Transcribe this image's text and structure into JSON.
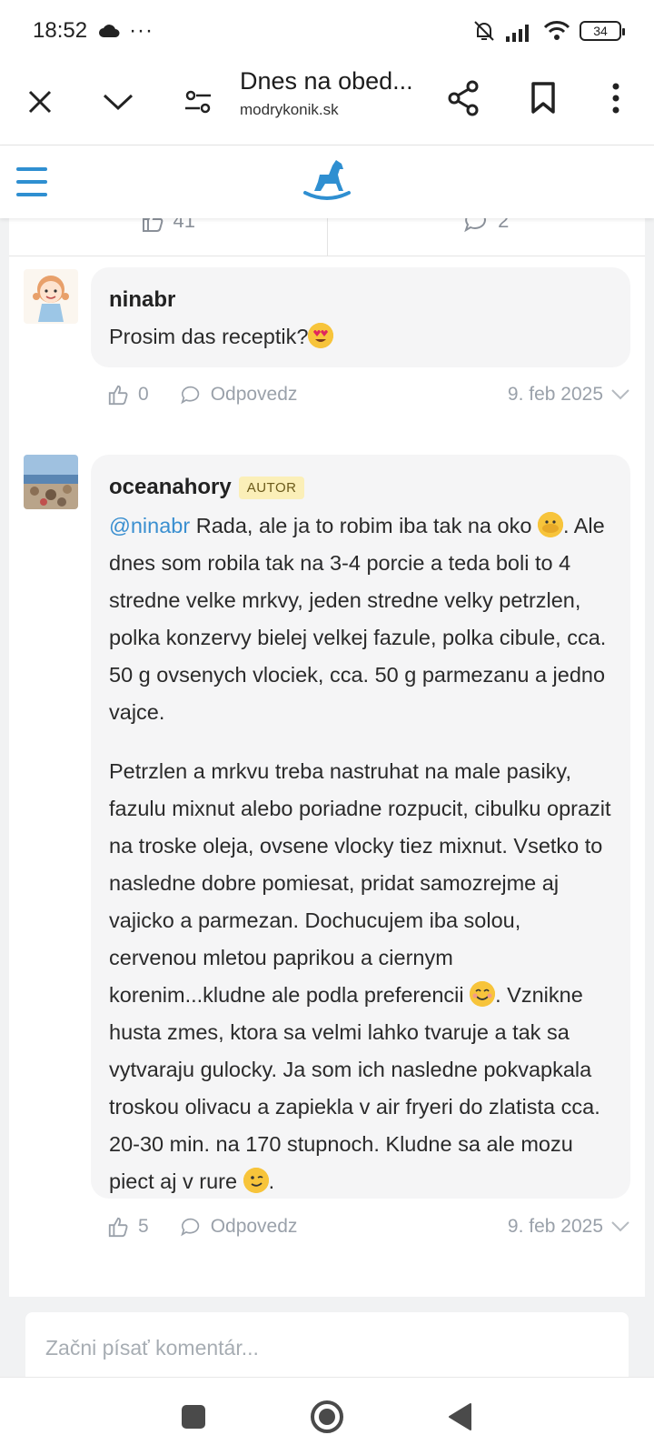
{
  "status_bar": {
    "time": "18:52",
    "overflow": "···",
    "battery": "34"
  },
  "toolbar": {
    "title": "Dnes na obed...",
    "url": "modrykonik.sk"
  },
  "stats": {
    "likes": "41",
    "comments": "2"
  },
  "comments": [
    {
      "author": "ninabr",
      "text": "Prosim das receptik?",
      "likes": "0",
      "reply_label": "Odpovedz",
      "date": "9. feb 2025"
    },
    {
      "author": "oceanahory",
      "badge": "AUTOR",
      "mention": "@ninabr",
      "p1": " Rada, ale ja to robim iba tak na oko ",
      "p1_end": ". Ale dnes som robila tak na 3-4 porcie a teda boli to 4 stredne velke mrkvy, jeden stredne velky petrzlen, polka konzervy bielej velkej fazule, polka cibule, cca. 50 g ovsenych vlociek, cca. 50 g parmezanu a jedno vajce.",
      "p2a": "Petrzlen a mrkvu treba nastruhat na male pasiky, fazulu mixnut alebo poriadne rozpucit, cibulku oprazit na troske oleja, ovsene vlocky tiez mixnut. Vsetko to nasledne dobre pomiesat, pridat samozrejme aj vajicko a parmezan. Dochucujem iba solou, cervenou mletou paprikou a ciernym korenim...kludne ale podla preferencii ",
      "p2b": ". Vznikne husta zmes, ktora sa velmi lahko tvaruje a tak sa vytvaraju gulocky. Ja som ich nasledne pokvapkala troskou olivacu a zapiekla v air fryeri do zlatista cca. 20-30 min. na 170 stupnoch. Kludne sa ale mozu piect aj v rure ",
      "p2_end": ".",
      "likes": "5",
      "reply_label": "Odpovedz",
      "date": "9. feb 2025"
    }
  ],
  "comment_input": {
    "placeholder": "Začni písať komentár..."
  },
  "colors": {
    "accent": "#2f8fd1",
    "mention": "#3a8fd0",
    "bubble": "#f5f5f6",
    "badge_bg": "#fbefb8"
  }
}
